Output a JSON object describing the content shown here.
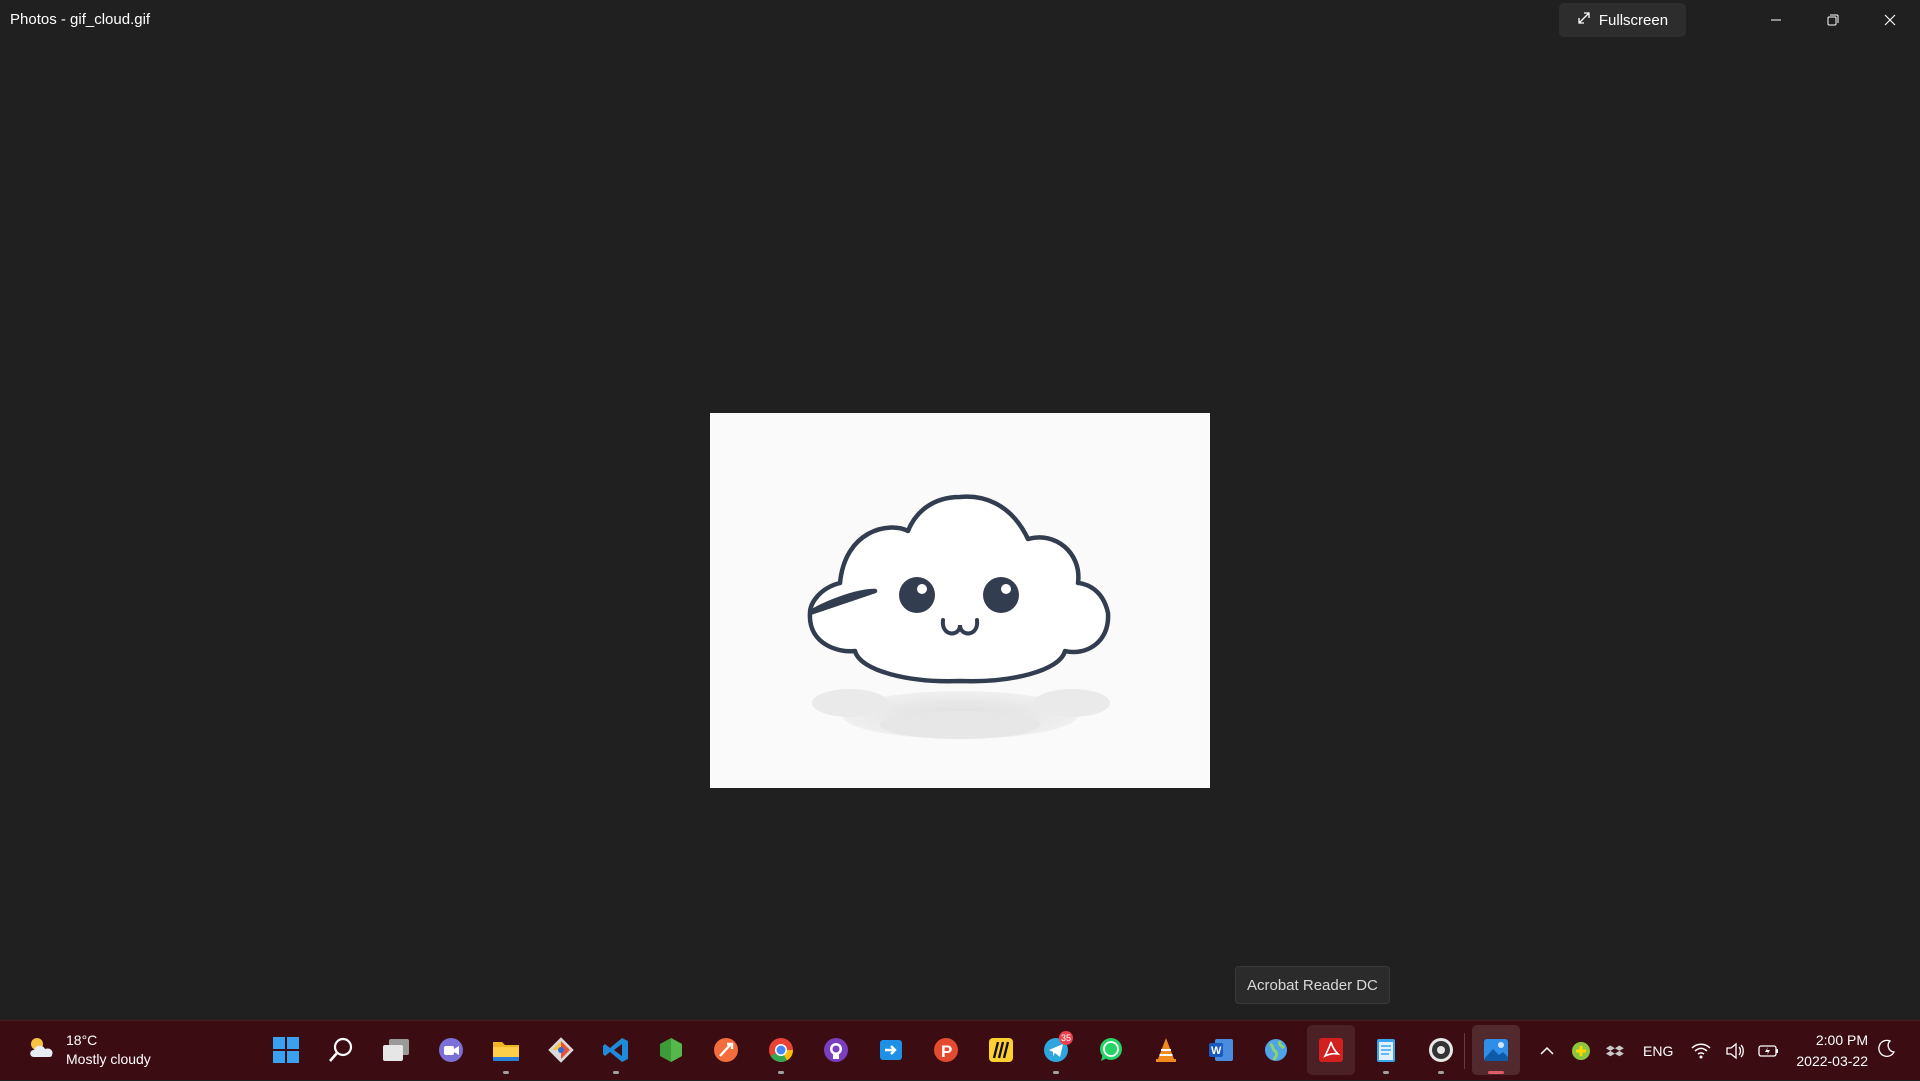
{
  "window": {
    "title": "Photos - gif_cloud.gif",
    "fullscreen_label": "Fullscreen"
  },
  "tooltip": {
    "text": "Acrobat Reader DC"
  },
  "weather": {
    "temperature": "18°C",
    "condition": "Mostly cloudy"
  },
  "taskbar": {
    "apps": [
      {
        "name": "start",
        "icon": "windows-logo-icon"
      },
      {
        "name": "search",
        "icon": "search-icon"
      },
      {
        "name": "task-view",
        "icon": "task-view-icon"
      },
      {
        "name": "teams-chat",
        "icon": "video-chat-icon"
      },
      {
        "name": "file-explorer",
        "icon": "folder-icon"
      },
      {
        "name": "git",
        "icon": "git-icon"
      },
      {
        "name": "vscode",
        "icon": "vscode-icon"
      },
      {
        "name": "nodejs",
        "icon": "hexagon-icon"
      },
      {
        "name": "postman",
        "icon": "postman-icon"
      },
      {
        "name": "chrome",
        "icon": "chrome-icon"
      },
      {
        "name": "github-desktop",
        "icon": "github-icon"
      },
      {
        "name": "remote-desktop",
        "icon": "remote-icon"
      },
      {
        "name": "producthunt",
        "icon": "p-icon"
      },
      {
        "name": "miro",
        "icon": "miro-icon"
      },
      {
        "name": "telegram",
        "icon": "telegram-icon",
        "badge": "35"
      },
      {
        "name": "whatsapp",
        "icon": "whatsapp-icon"
      },
      {
        "name": "vlc",
        "icon": "vlc-cone-icon"
      },
      {
        "name": "word",
        "icon": "word-icon"
      },
      {
        "name": "network-globe",
        "icon": "globe-icon"
      },
      {
        "name": "acrobat-reader",
        "icon": "acrobat-icon"
      },
      {
        "name": "notepad",
        "icon": "notepad-icon"
      },
      {
        "name": "obs",
        "icon": "record-icon"
      },
      {
        "name": "photos",
        "icon": "photos-icon"
      }
    ]
  },
  "tray": {
    "language": "ENG"
  },
  "clock": {
    "time": "2:00 PM",
    "date": "2022-03-22"
  },
  "colors": {
    "taskbar_bg": "#3b0c11",
    "window_bg": "#202020",
    "accent": "#e05a6a"
  }
}
